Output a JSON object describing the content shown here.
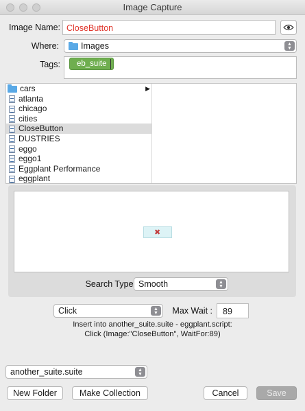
{
  "window": {
    "title": "Image Capture"
  },
  "image_name": {
    "label": "Image Name:",
    "value": "CloseButton"
  },
  "where": {
    "label": "Where:",
    "value": "Images"
  },
  "tags": {
    "label": "Tags:",
    "items": [
      "eb_suite"
    ]
  },
  "browser": {
    "items": [
      {
        "name": "cars",
        "type": "folder",
        "selected": false
      },
      {
        "name": "atlanta",
        "type": "file",
        "selected": false
      },
      {
        "name": "chicago",
        "type": "file",
        "selected": false
      },
      {
        "name": "cities",
        "type": "file",
        "selected": false
      },
      {
        "name": "CloseButton",
        "type": "file",
        "selected": true
      },
      {
        "name": "DUSTRIES",
        "type": "file",
        "selected": false
      },
      {
        "name": "eggo",
        "type": "file",
        "selected": false
      },
      {
        "name": "eggo1",
        "type": "file",
        "selected": false
      },
      {
        "name": "Eggplant Performance",
        "type": "file",
        "selected": false
      },
      {
        "name": "eggplant",
        "type": "file",
        "selected": false
      }
    ]
  },
  "search_type": {
    "label": "Search Type:",
    "value": "Smooth"
  },
  "action": {
    "value": "Click"
  },
  "max_wait": {
    "label": "Max Wait :",
    "value": "89"
  },
  "insert_info": {
    "line1": "Insert into another_suite.suite - eggplant.script:",
    "line2": "Click (Image:\"CloseButton\", WaitFor:89)"
  },
  "suite": {
    "value": "another_suite.suite"
  },
  "buttons": {
    "new_folder": "New Folder",
    "make_collection": "Make Collection",
    "cancel": "Cancel",
    "save": "Save"
  },
  "colors": {
    "name_text": "#e0352b",
    "tag_bg": "#6fae4f",
    "folder": "#5aa9e6"
  }
}
